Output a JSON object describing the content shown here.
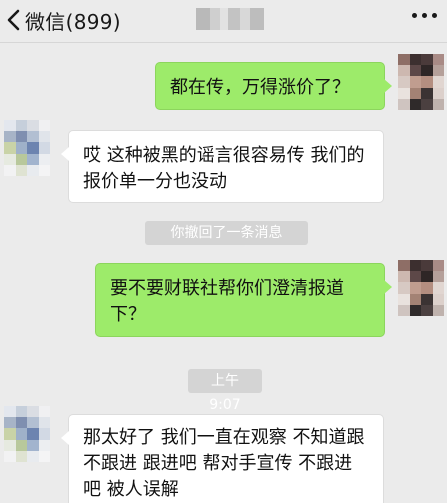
{
  "nav": {
    "back_label": "微信(899)"
  },
  "messages": [
    {
      "side": "right",
      "text": "都在传，万得涨价了？"
    },
    {
      "side": "left",
      "text": "哎 这种被黑的谣言很容易传 我们的报价单一分也没动"
    },
    {
      "type": "system",
      "text": "你撤回了一条消息"
    },
    {
      "side": "right",
      "text": "要不要财联社帮你们澄清报道下？"
    },
    {
      "type": "time",
      "text": "上午9:07"
    },
    {
      "side": "left",
      "text": "那太好了 我们一直在观察 不知道跟不跟进 跟进吧 帮对手宣传 不跟进吧 被人误解"
    }
  ],
  "colors": {
    "background": "#ebebeb",
    "sent_bubble": "#9deb6a",
    "received_bubble": "#ffffff",
    "chip": "#d4d4d4"
  },
  "icons": {
    "back": "chevron-left-icon",
    "more": "more-dots-icon"
  }
}
